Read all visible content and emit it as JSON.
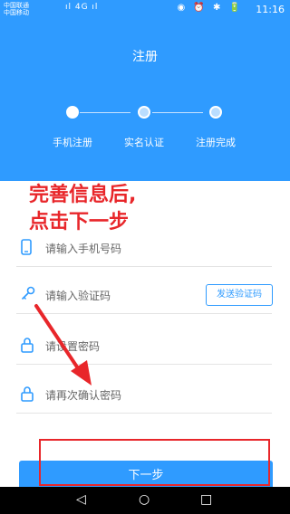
{
  "status_bar": {
    "carrier_1": "中国联通",
    "carrier_2": "中国移动",
    "signal_icons": "ıl 4G ıl",
    "right_icons": "◉ ⏰ ✱ 🔋",
    "time": "11:16"
  },
  "header": {
    "title": "注册",
    "steps": [
      {
        "label": "手机注册",
        "state": "active"
      },
      {
        "label": "实名认证",
        "state": "inactive"
      },
      {
        "label": "注册完成",
        "state": "inactive"
      }
    ]
  },
  "annotation": {
    "line_1": "完善信息后,",
    "line_2": "点击下一步",
    "color": "#e8262a"
  },
  "form": {
    "phone_placeholder": "请输入手机号码",
    "code_placeholder": "请输入验证码",
    "send_code_label": "发送验证码",
    "password_placeholder": "请设置密码",
    "confirm_placeholder": "请再次确认密码"
  },
  "next_button": "下一步",
  "nav": {
    "back_icon": "◁",
    "home_icon": "○",
    "recent_icon": "□"
  },
  "colors": {
    "brand": "#2f9bff",
    "annotation": "#e8262a"
  }
}
